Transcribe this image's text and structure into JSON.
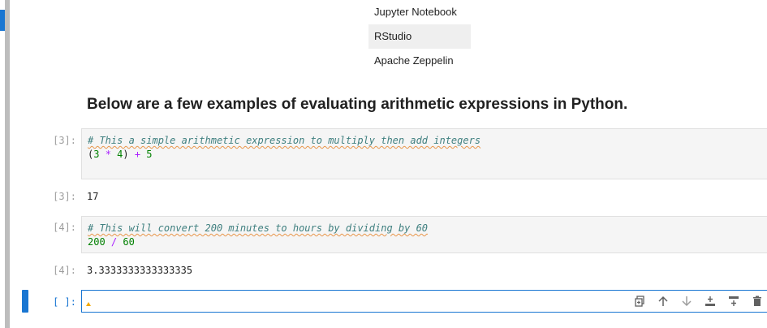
{
  "table": {
    "rows": [
      "Jupyter Notebook",
      "RStudio",
      "Apache Zeppelin"
    ]
  },
  "heading": "Below are a few examples of evaluating arithmetic expressions in Python.",
  "cells": [
    {
      "in_prompt": "[3]:",
      "comment": "# This a simple arithmetic expression to multiply then add integers",
      "code": {
        "p1": "(",
        "n1": "3",
        "op1": " * ",
        "n2": "4",
        "p2": ") ",
        "op2": "+",
        "n3": " 5"
      },
      "out_prompt": "[3]:",
      "output": "17"
    },
    {
      "in_prompt": "[4]:",
      "comment": "# This will convert 200 minutes to hours by dividing by 60",
      "code": {
        "n1": "200",
        "op1": " / ",
        "n2": "60"
      },
      "out_prompt": "[4]:",
      "output": "3.3333333333333335"
    }
  ],
  "active_cell": {
    "in_prompt": "[ ]:"
  },
  "toolbar": {
    "icons": [
      "duplicate-icon",
      "move-up-icon",
      "move-down-icon",
      "insert-above-icon",
      "insert-below-icon",
      "delete-icon"
    ]
  },
  "colors": {
    "accent": "#1976d2",
    "comment": "#408080",
    "number": "#008000",
    "operator": "#aa22ff"
  }
}
